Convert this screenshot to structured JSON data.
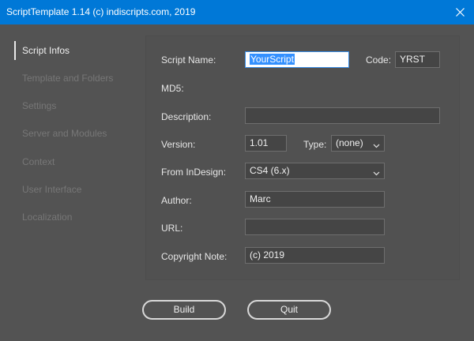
{
  "window": {
    "title": "ScriptTemplate 1.14  (c) indiscripts.com, 2019",
    "close_icon": "close-icon"
  },
  "sidebar": {
    "items": [
      {
        "label": "Script Infos",
        "active": true
      },
      {
        "label": "Template and Folders",
        "active": false
      },
      {
        "label": "Settings",
        "active": false
      },
      {
        "label": "Server and Modules",
        "active": false
      },
      {
        "label": "Context",
        "active": false
      },
      {
        "label": "User Interface",
        "active": false
      },
      {
        "label": "Localization",
        "active": false
      }
    ]
  },
  "form": {
    "script_name": {
      "label": "Script Name:",
      "value": "YourScript"
    },
    "code": {
      "label": "Code:",
      "value": "YRST"
    },
    "md5": {
      "label": "MD5:"
    },
    "description": {
      "label": "Description:",
      "value": ""
    },
    "version": {
      "label": "Version:",
      "value": "1.01"
    },
    "type": {
      "label": "Type:",
      "value": "(none)"
    },
    "from_indesign": {
      "label": "From InDesign:",
      "value": "CS4 (6.x)"
    },
    "author": {
      "label": "Author:",
      "value": "Marc"
    },
    "url": {
      "label": "URL:",
      "value": ""
    },
    "copyright": {
      "label": "Copyright Note:",
      "value": "(c) 2019"
    }
  },
  "buttons": {
    "build": "Build",
    "quit": "Quit"
  },
  "colors": {
    "titlebar": "#0078d7",
    "background": "#535353",
    "selection": "#3390ff"
  }
}
